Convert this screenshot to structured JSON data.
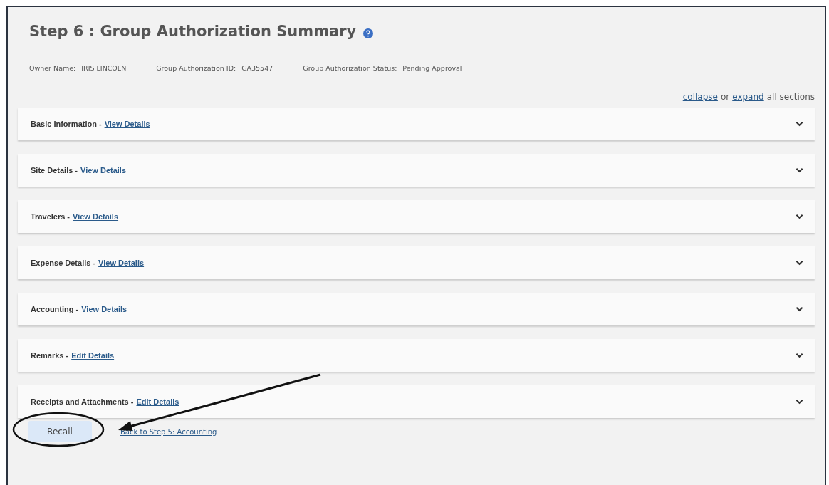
{
  "title": "Step 6 : Group Authorization Summary",
  "info": [
    {
      "label": "Owner Name:",
      "value": "IRIS LINCOLN"
    },
    {
      "label": "Group Authorization ID:",
      "value": "GA35547"
    },
    {
      "label": "Group Authorization Status:",
      "value": "Pending Approval"
    }
  ],
  "toggle_all": {
    "collapse": "collapse",
    "or": "or",
    "expand": "expand",
    "suffix": "all sections"
  },
  "sections": [
    {
      "label": "Basic Information -",
      "link": "View Details",
      "expanded": false
    },
    {
      "label": "Site Details -",
      "link": "View Details",
      "expanded": false
    },
    {
      "label": "Travelers -",
      "link": "View Details",
      "expanded": false
    },
    {
      "label": "Expense Details -",
      "link": "View Details",
      "expanded": false
    },
    {
      "label": "Accounting -",
      "link": "View Details",
      "expanded": false
    },
    {
      "label": "Remarks -",
      "link": "Edit Details",
      "expanded": false
    },
    {
      "label": "Receipts and Attachments -",
      "link": "Edit Details",
      "expanded": false
    }
  ],
  "recall_button": "Recall",
  "back_link": "Back to Step 5: Accounting"
}
